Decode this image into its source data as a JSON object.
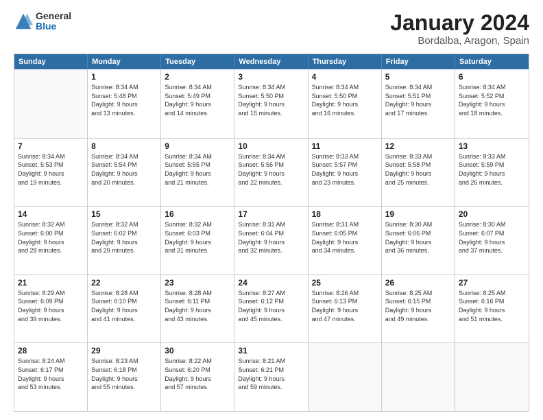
{
  "logo": {
    "general": "General",
    "blue": "Blue"
  },
  "header": {
    "month": "January 2024",
    "location": "Bordalba, Aragon, Spain"
  },
  "weekdays": [
    "Sunday",
    "Monday",
    "Tuesday",
    "Wednesday",
    "Thursday",
    "Friday",
    "Saturday"
  ],
  "weeks": [
    [
      {
        "day": "",
        "info": ""
      },
      {
        "day": "1",
        "info": "Sunrise: 8:34 AM\nSunset: 5:48 PM\nDaylight: 9 hours\nand 13 minutes."
      },
      {
        "day": "2",
        "info": "Sunrise: 8:34 AM\nSunset: 5:49 PM\nDaylight: 9 hours\nand 14 minutes."
      },
      {
        "day": "3",
        "info": "Sunrise: 8:34 AM\nSunset: 5:50 PM\nDaylight: 9 hours\nand 15 minutes."
      },
      {
        "day": "4",
        "info": "Sunrise: 8:34 AM\nSunset: 5:50 PM\nDaylight: 9 hours\nand 16 minutes."
      },
      {
        "day": "5",
        "info": "Sunrise: 8:34 AM\nSunset: 5:51 PM\nDaylight: 9 hours\nand 17 minutes."
      },
      {
        "day": "6",
        "info": "Sunrise: 8:34 AM\nSunset: 5:52 PM\nDaylight: 9 hours\nand 18 minutes."
      }
    ],
    [
      {
        "day": "7",
        "info": "Sunrise: 8:34 AM\nSunset: 5:53 PM\nDaylight: 9 hours\nand 19 minutes."
      },
      {
        "day": "8",
        "info": "Sunrise: 8:34 AM\nSunset: 5:54 PM\nDaylight: 9 hours\nand 20 minutes."
      },
      {
        "day": "9",
        "info": "Sunrise: 8:34 AM\nSunset: 5:55 PM\nDaylight: 9 hours\nand 21 minutes."
      },
      {
        "day": "10",
        "info": "Sunrise: 8:34 AM\nSunset: 5:56 PM\nDaylight: 9 hours\nand 22 minutes."
      },
      {
        "day": "11",
        "info": "Sunrise: 8:33 AM\nSunset: 5:57 PM\nDaylight: 9 hours\nand 23 minutes."
      },
      {
        "day": "12",
        "info": "Sunrise: 8:33 AM\nSunset: 5:58 PM\nDaylight: 9 hours\nand 25 minutes."
      },
      {
        "day": "13",
        "info": "Sunrise: 8:33 AM\nSunset: 5:59 PM\nDaylight: 9 hours\nand 26 minutes."
      }
    ],
    [
      {
        "day": "14",
        "info": "Sunrise: 8:32 AM\nSunset: 6:00 PM\nDaylight: 9 hours\nand 28 minutes."
      },
      {
        "day": "15",
        "info": "Sunrise: 8:32 AM\nSunset: 6:02 PM\nDaylight: 9 hours\nand 29 minutes."
      },
      {
        "day": "16",
        "info": "Sunrise: 8:32 AM\nSunset: 6:03 PM\nDaylight: 9 hours\nand 31 minutes."
      },
      {
        "day": "17",
        "info": "Sunrise: 8:31 AM\nSunset: 6:04 PM\nDaylight: 9 hours\nand 32 minutes."
      },
      {
        "day": "18",
        "info": "Sunrise: 8:31 AM\nSunset: 6:05 PM\nDaylight: 9 hours\nand 34 minutes."
      },
      {
        "day": "19",
        "info": "Sunrise: 8:30 AM\nSunset: 6:06 PM\nDaylight: 9 hours\nand 36 minutes."
      },
      {
        "day": "20",
        "info": "Sunrise: 8:30 AM\nSunset: 6:07 PM\nDaylight: 9 hours\nand 37 minutes."
      }
    ],
    [
      {
        "day": "21",
        "info": "Sunrise: 8:29 AM\nSunset: 6:09 PM\nDaylight: 9 hours\nand 39 minutes."
      },
      {
        "day": "22",
        "info": "Sunrise: 8:28 AM\nSunset: 6:10 PM\nDaylight: 9 hours\nand 41 minutes."
      },
      {
        "day": "23",
        "info": "Sunrise: 8:28 AM\nSunset: 6:11 PM\nDaylight: 9 hours\nand 43 minutes."
      },
      {
        "day": "24",
        "info": "Sunrise: 8:27 AM\nSunset: 6:12 PM\nDaylight: 9 hours\nand 45 minutes."
      },
      {
        "day": "25",
        "info": "Sunrise: 8:26 AM\nSunset: 6:13 PM\nDaylight: 9 hours\nand 47 minutes."
      },
      {
        "day": "26",
        "info": "Sunrise: 8:25 AM\nSunset: 6:15 PM\nDaylight: 9 hours\nand 49 minutes."
      },
      {
        "day": "27",
        "info": "Sunrise: 8:25 AM\nSunset: 6:16 PM\nDaylight: 9 hours\nand 51 minutes."
      }
    ],
    [
      {
        "day": "28",
        "info": "Sunrise: 8:24 AM\nSunset: 6:17 PM\nDaylight: 9 hours\nand 53 minutes."
      },
      {
        "day": "29",
        "info": "Sunrise: 8:23 AM\nSunset: 6:18 PM\nDaylight: 9 hours\nand 55 minutes."
      },
      {
        "day": "30",
        "info": "Sunrise: 8:22 AM\nSunset: 6:20 PM\nDaylight: 9 hours\nand 57 minutes."
      },
      {
        "day": "31",
        "info": "Sunrise: 8:21 AM\nSunset: 6:21 PM\nDaylight: 9 hours\nand 59 minutes."
      },
      {
        "day": "",
        "info": ""
      },
      {
        "day": "",
        "info": ""
      },
      {
        "day": "",
        "info": ""
      }
    ]
  ]
}
